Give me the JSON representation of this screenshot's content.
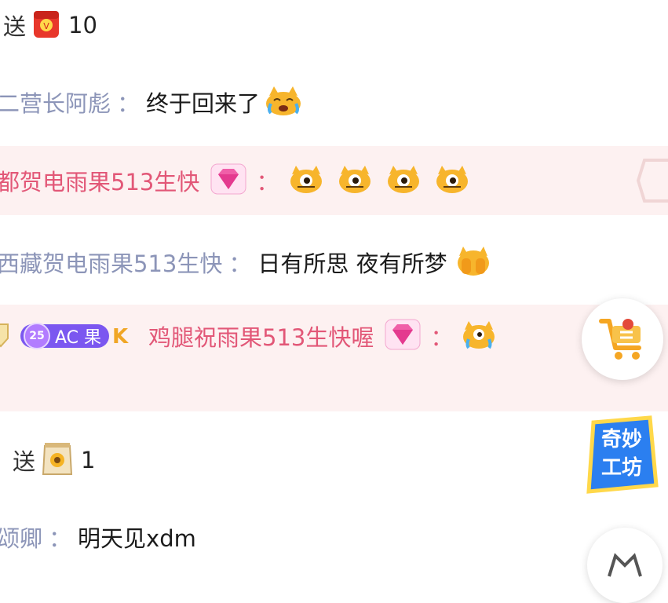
{
  "chat": {
    "gift1": {
      "verb": "送",
      "count": "10",
      "gift_icon": "red-envelope-gift-icon"
    },
    "msg1": {
      "nick": "二营长阿彪",
      "colon": "：",
      "text": "终于回来了",
      "emoji": "crying-cat-emoji-icon"
    },
    "msg2": {
      "nick": "都贺电雨果513生快",
      "colon": "：",
      "badge": "diamond-noble-icon"
    },
    "msg3": {
      "nick": "西藏贺电雨果513生快",
      "colon": "：",
      "text": "日有所思 夜有所梦",
      "emoji": "covering-face-cat-emoji-icon"
    },
    "msg4": {
      "medal_level": "25",
      "medal_name": "AC 果",
      "nick": "鸡腿祝雨果513生快喔",
      "colon": "：",
      "badge": "diamond-noble-icon"
    },
    "gift2": {
      "verb": "送",
      "count": "1",
      "gift_icon": "snack-bag-gift-icon"
    },
    "msg5": {
      "nick": "颂卿",
      "colon": "：",
      "text": "明天见xdm"
    }
  },
  "floating": {
    "shop_icon": "shopping-cart-icon",
    "promo_line1": "奇妙",
    "promo_line2": "工坊"
  },
  "colors": {
    "nick": "#8c95b8",
    "nick_highlight": "#e25777",
    "highlight_bg": "#fdf1f1"
  }
}
